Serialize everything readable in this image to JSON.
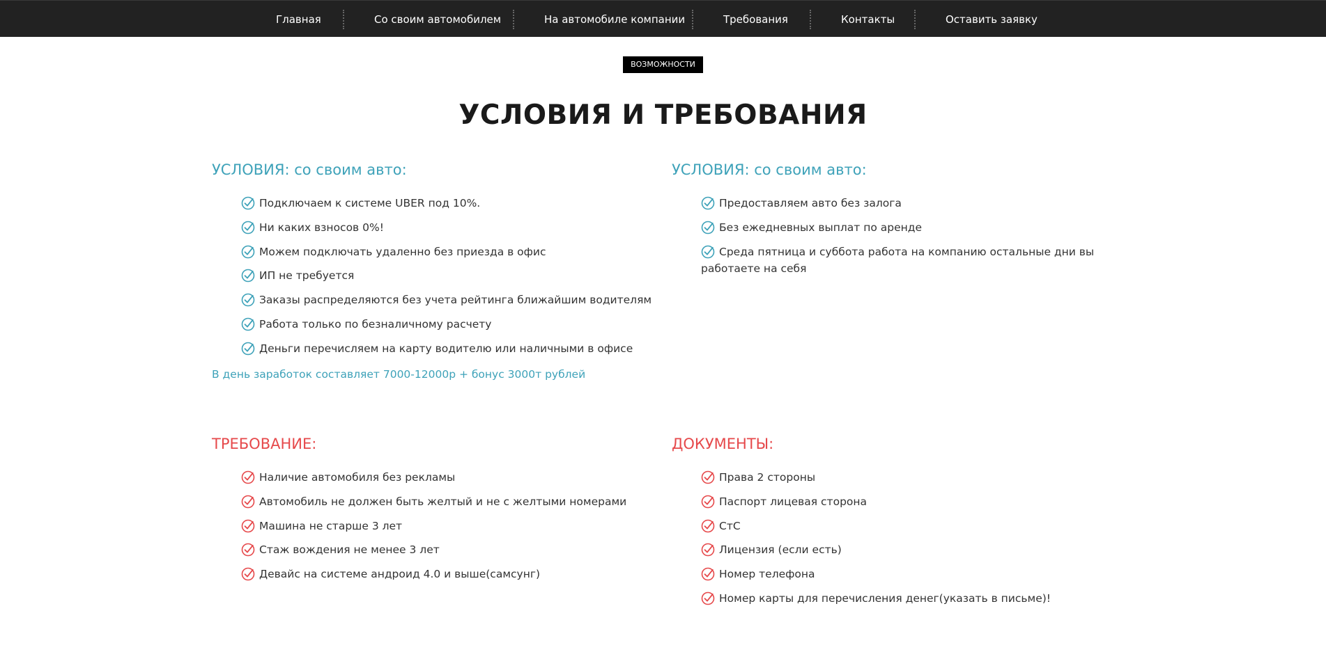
{
  "nav": {
    "items": [
      "Главная",
      "Со своим автомобилем",
      "На автомобиле компании",
      "Требования",
      "Контакты",
      "Оставить заявку"
    ]
  },
  "badge": "возможности",
  "page_title": "УСЛОВИЯ И ТРЕБОВАНИЯ",
  "colors": {
    "accent_blue": "#3ea2b9",
    "accent_red": "#e6494b",
    "nav_bg": "#222222"
  },
  "conditions_own": {
    "heading": "УСЛОВИЯ: со своим авто:",
    "items": [
      "Подключаем к системе UBER под 10%.",
      "Ни каких взносов 0%!",
      "Можем подключать удаленно без приезда в офис",
      "ИП не требуется",
      "Заказы распределяются без учета рейтинга ближайшим водителям",
      "Работа только по безналичному расчету",
      "Деньги перечисляем на карту водителю или наличными в офисе"
    ],
    "note": "В день заработок составляет 7000-12000р + бонус 3000т рублей"
  },
  "conditions_company": {
    "heading": "УСЛОВИЯ: со своим авто:",
    "items": [
      "Предоставляем авто без залога",
      "Без ежедневных выплат по аренде",
      "Среда пятница и суббота работа на компанию остальные дни вы работаете на себя"
    ]
  },
  "requirements": {
    "heading": "ТРЕБОВАНИЕ:",
    "items": [
      "Наличие автомобиля без рекламы",
      "Автомобиль не должен быть желтый и не с желтыми номерами",
      "Машина не старше 3 лет",
      "Стаж вождения не менее 3 лет",
      "Девайс на системе андроид 4.0 и выше(самсунг)"
    ]
  },
  "documents": {
    "heading": "ДОКУМЕНТЫ:",
    "items": [
      "Права 2 стороны",
      "Паспорт лицевая сторона",
      "СтС",
      "Лицензия (если есть)",
      "Номер телефона",
      "Номер карты для перечисления денег(указать в письме)!"
    ]
  }
}
